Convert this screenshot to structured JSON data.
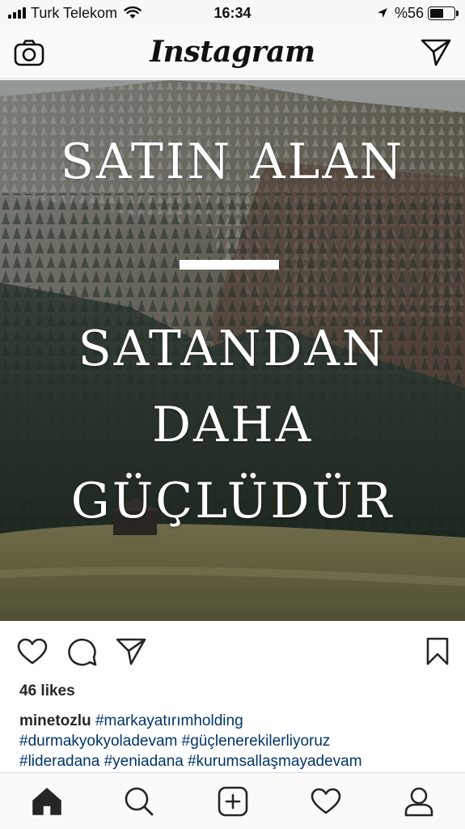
{
  "status_bar": {
    "carrier": "Turk Telekom",
    "time": "16:34",
    "battery": "%56",
    "battery_level": 0.56
  },
  "header": {
    "logo": "Instagram",
    "left_icon": "camera-icon",
    "right_icon": "direct-message-icon"
  },
  "post": {
    "image_text": {
      "line1": "SATIN ALAN",
      "line2": "SATANDAN",
      "line3": "DAHA",
      "line4": "GÜÇLÜDÜR"
    },
    "actions": [
      "heart-icon",
      "comment-icon",
      "share-icon",
      "bookmark-icon"
    ],
    "likes": "46 likes",
    "caption": {
      "username": "minetozlu",
      "tags_line1": "#markayatırımholding",
      "tags_line2": "#durmakyokyoladevam #güçlenerekilerliyoruz",
      "tags_line3": "#lideradana #yeniadana #kurumsallaşmayadevam"
    }
  },
  "bottom_nav": {
    "items": [
      "home-icon",
      "search-icon",
      "add-post-icon",
      "activity-heart-icon",
      "profile-icon"
    ],
    "active": "home-icon"
  },
  "colors": {
    "hashtag": "#003569",
    "text": "#262626",
    "border": "#dbdbdb"
  }
}
